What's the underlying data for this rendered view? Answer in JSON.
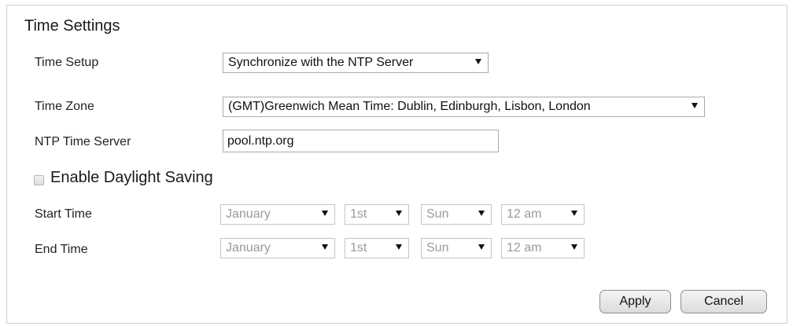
{
  "title": "Time Settings",
  "time_setup": {
    "label": "Time Setup",
    "value": "Synchronize with the NTP Server"
  },
  "time_zone": {
    "label": "Time Zone",
    "value": "(GMT)Greenwich Mean Time: Dublin, Edinburgh, Lisbon, London"
  },
  "ntp_server": {
    "label": "NTP Time Server",
    "value": "pool.ntp.org"
  },
  "daylight": {
    "label": "Enable Daylight Saving",
    "checked": false
  },
  "start_time": {
    "label": "Start Time",
    "month": "January",
    "week": "1st",
    "day": "Sun",
    "hour": "12 am"
  },
  "end_time": {
    "label": "End Time",
    "month": "January",
    "week": "1st",
    "day": "Sun",
    "hour": "12 am"
  },
  "buttons": {
    "apply": "Apply",
    "cancel": "Cancel"
  }
}
